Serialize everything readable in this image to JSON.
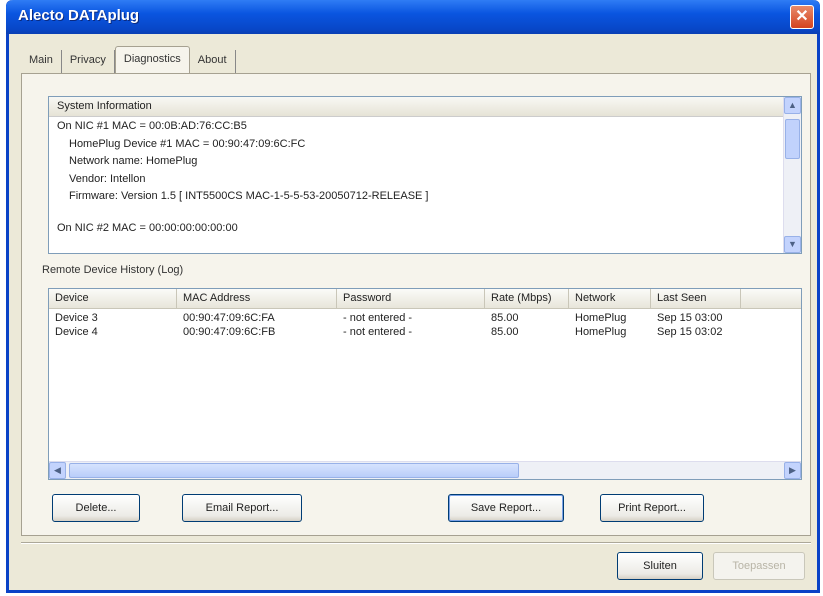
{
  "window": {
    "title": "Alecto DATAplug",
    "close_label": "✕"
  },
  "tabs": [
    {
      "label": "Main",
      "active": false
    },
    {
      "label": "Privacy",
      "active": false
    },
    {
      "label": "Diagnostics",
      "active": true
    },
    {
      "label": "About",
      "active": false
    }
  ],
  "system_info": {
    "header": "System Information",
    "lines": [
      "On NIC #1 MAC = 00:0B:AD:76:CC:B5",
      "HomePlug Device #1 MAC = 00:90:47:09:6C:FC",
      "Network name: HomePlug",
      "Vendor: Intellon",
      "Firmware: Version 1.5   [ INT5500CS MAC-1-5-5-53-20050712-RELEASE ]",
      "On NIC #2 MAC = 00:00:00:00:00:00"
    ]
  },
  "remote_log": {
    "label": "Remote Device History (Log)",
    "columns": [
      "Device",
      "MAC Address",
      "Password",
      "Rate (Mbps)",
      "Network",
      "Last Seen"
    ],
    "rows": [
      [
        "Device 3",
        "00:90:47:09:6C:FA",
        "- not entered -",
        "85.00",
        "HomePlug",
        "Sep 15 03:00"
      ],
      [
        "Device 4",
        "00:90:47:09:6C:FB",
        "- not entered -",
        "85.00",
        "HomePlug",
        "Sep 15 03:02"
      ]
    ]
  },
  "buttons": {
    "delete": "Delete...",
    "email_report": "Email Report...",
    "save_report": "Save Report...",
    "print_report": "Print Report...",
    "close": "Sluiten",
    "apply": "Toepassen"
  },
  "colors": {
    "titlebar": "#0a55e0",
    "dialog_bg": "#ece9d8",
    "button_border": "#003c74"
  }
}
